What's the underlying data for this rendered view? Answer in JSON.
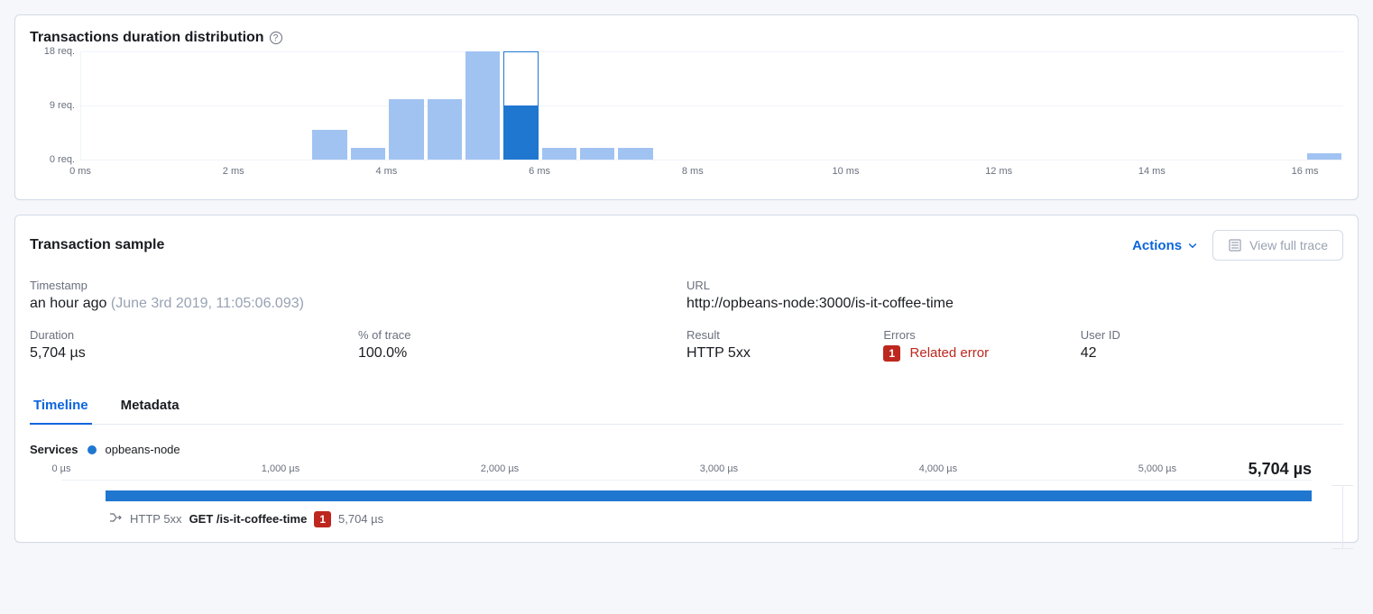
{
  "histogram": {
    "title": "Transactions duration distribution",
    "y_ticks": [
      "18 req.",
      "9 req.",
      "0 req."
    ],
    "y_max": 18,
    "x_ticks": [
      "0 ms",
      "2 ms",
      "4 ms",
      "6 ms",
      "8 ms",
      "10 ms",
      "12 ms",
      "14 ms",
      "16 ms"
    ],
    "x_max_ms": 16.5
  },
  "chart_data": {
    "type": "bar",
    "title": "Transactions duration distribution",
    "xlabel": "",
    "ylabel": "req.",
    "ylim": [
      0,
      18
    ],
    "bin_width_ms": 0.5,
    "categories_ms_start": [
      3.0,
      3.5,
      4.0,
      4.5,
      5.0,
      5.5,
      6.0,
      6.5,
      7.0,
      16.0
    ],
    "values": [
      5,
      2,
      10,
      10,
      18,
      18,
      2,
      2,
      2,
      1
    ],
    "selected_bin_index": 5,
    "selected_bin_filled_value": 9
  },
  "sample": {
    "title": "Transaction sample",
    "actions_label": "Actions",
    "trace_button": "View full trace",
    "fields": {
      "timestamp_label": "Timestamp",
      "timestamp_relative": "an hour ago",
      "timestamp_absolute": "(June 3rd 2019, 11:05:06.093)",
      "url_label": "URL",
      "url_value": "http://opbeans-node:3000/is-it-coffee-time",
      "duration_label": "Duration",
      "duration_value": "5,704 µs",
      "pct_label": "% of trace",
      "pct_value": "100.0%",
      "result_label": "Result",
      "result_value": "HTTP 5xx",
      "errors_label": "Errors",
      "errors_count": "1",
      "errors_link": "Related error",
      "userid_label": "User ID",
      "userid_value": "42"
    },
    "tabs": {
      "timeline": "Timeline",
      "metadata": "Metadata"
    }
  },
  "timeline": {
    "services_label": "Services",
    "service_name": "opbeans-node",
    "ticks": [
      "0 µs",
      "1,000 µs",
      "2,000 µs",
      "3,000 µs",
      "4,000 µs",
      "5,000 µs"
    ],
    "total_label": "5,704 µs",
    "total_us": 5704,
    "span": {
      "http": "HTTP 5xx",
      "name": "GET /is-it-coffee-time",
      "badge": "1",
      "duration": "5,704 µs",
      "start_us": 200,
      "end_us": 5704
    }
  }
}
